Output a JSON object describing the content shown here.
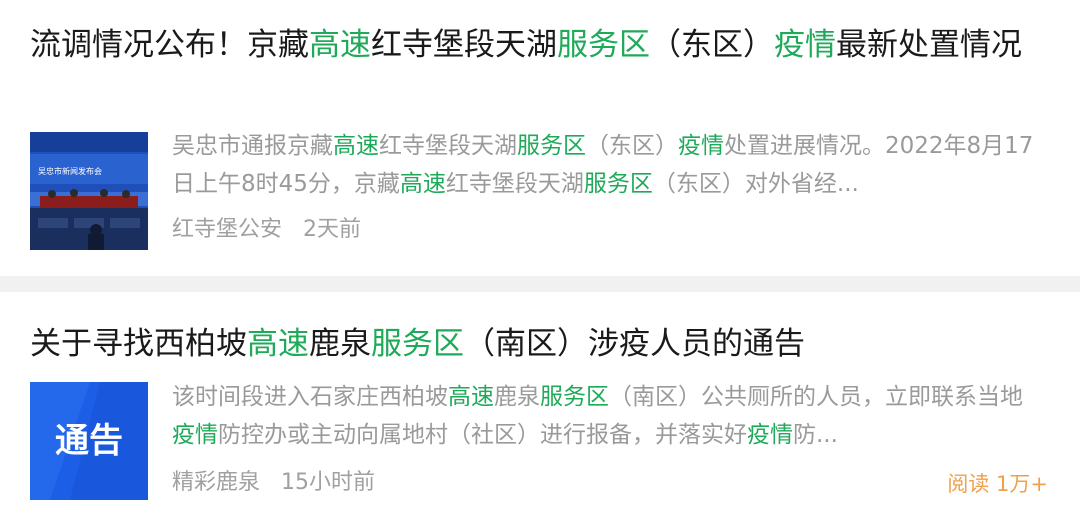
{
  "articles": [
    {
      "title_parts": [
        {
          "text": "流调情况公布！京藏",
          "hl": false
        },
        {
          "text": "高速",
          "hl": true
        },
        {
          "text": "红寺堡段天湖",
          "hl": false
        },
        {
          "text": "服务区",
          "hl": true
        },
        {
          "text": "（东区）",
          "hl": false
        },
        {
          "text": "疫情",
          "hl": true
        },
        {
          "text": "最新处置情况",
          "hl": false
        }
      ],
      "snippet_parts": [
        {
          "text": "吴忠市通报京藏",
          "hl": false
        },
        {
          "text": "高速",
          "hl": true
        },
        {
          "text": "红寺堡段天湖",
          "hl": false
        },
        {
          "text": "服务区",
          "hl": true
        },
        {
          "text": "（东区）",
          "hl": false
        },
        {
          "text": "疫情",
          "hl": true
        },
        {
          "text": "处置进展情况。2022年8月17日上午8时45分，京藏",
          "hl": false
        },
        {
          "text": "高速",
          "hl": true
        },
        {
          "text": "红寺堡段天湖",
          "hl": false
        },
        {
          "text": "服务区",
          "hl": true
        },
        {
          "text": "（东区）对外省经...",
          "hl": false
        }
      ],
      "thumbnail": {
        "icon": "press-conference-photo",
        "banner_text": "吴忠市新闻发布会"
      },
      "source": "红寺堡公安",
      "time": "2天前"
    },
    {
      "title_parts": [
        {
          "text": "关于寻找西柏坡",
          "hl": false
        },
        {
          "text": "高速",
          "hl": true
        },
        {
          "text": "鹿泉",
          "hl": false
        },
        {
          "text": "服务区",
          "hl": true
        },
        {
          "text": "（南区）涉疫人员的通告",
          "hl": false
        }
      ],
      "snippet_parts": [
        {
          "text": "该时间段进入石家庄西柏坡",
          "hl": false
        },
        {
          "text": "高速",
          "hl": true
        },
        {
          "text": "鹿泉",
          "hl": false
        },
        {
          "text": "服务区",
          "hl": true
        },
        {
          "text": "（南区）公共厕所的人员，立即联系当地",
          "hl": false
        },
        {
          "text": "疫情",
          "hl": true
        },
        {
          "text": "防控办或主动向属地村（社区）进行报备，并落实好",
          "hl": false
        },
        {
          "text": "疫情",
          "hl": true
        },
        {
          "text": "防...",
          "hl": false
        }
      ],
      "thumbnail": {
        "icon": "notice-banner",
        "text": "通告"
      },
      "source": "精彩鹿泉",
      "time": "15小时前",
      "read_count": "阅读 1万+"
    }
  ],
  "colors": {
    "highlight": "#1faa5a",
    "read_count": "#f0a04a",
    "meta": "#a0a0a0",
    "divider": "#f1f1f1"
  }
}
